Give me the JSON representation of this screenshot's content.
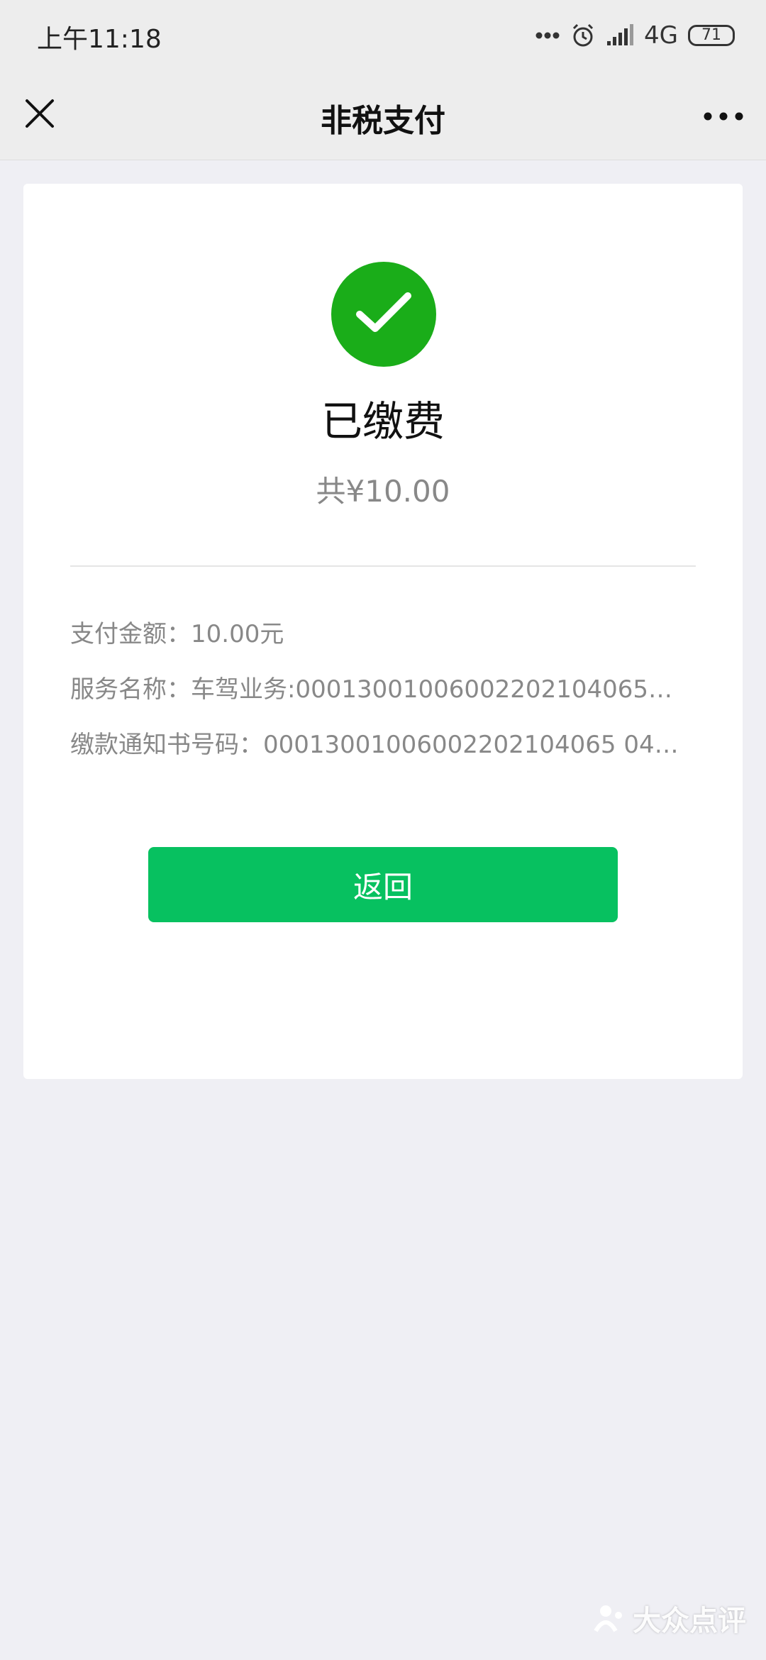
{
  "status_bar": {
    "time": "上午11:18",
    "network": "4G",
    "battery": "71"
  },
  "header": {
    "title": "非税支付"
  },
  "result": {
    "status": "已缴费",
    "total": "共¥10.00"
  },
  "details": [
    {
      "label": "支付金额：",
      "value": "10.00元"
    },
    {
      "label": "服务名称：",
      "value": "车驾业务:00013001006002202104065…"
    },
    {
      "label": "缴款通知书号码：",
      "value": "00013001006002202104065 04…"
    }
  ],
  "actions": {
    "return_label": "返回"
  },
  "watermark": {
    "text": "大众点评"
  },
  "colors": {
    "success": "#1aad19",
    "primary_button": "#07c160",
    "page_background": "#efeff4"
  }
}
